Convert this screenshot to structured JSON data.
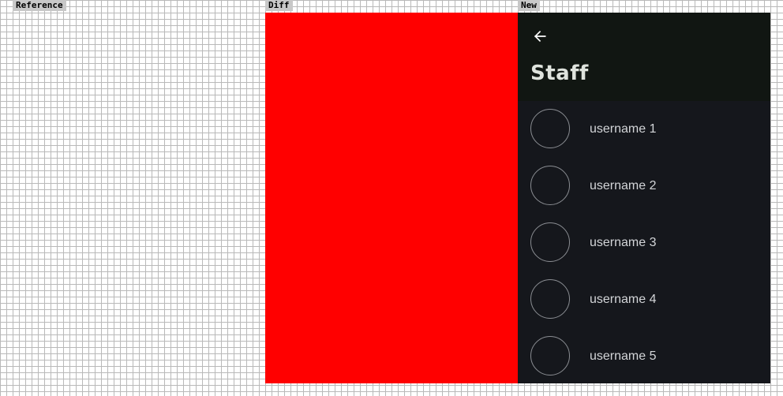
{
  "labels": {
    "reference": "Reference",
    "diff": "Diff",
    "new": "New"
  },
  "colors": {
    "diff_fill": "#ff0000",
    "header_bg": "#111612",
    "list_bg": "#15171c",
    "title_color": "#dfe3dd",
    "text_color": "#d3d5d8",
    "avatar_border": "#8a8d92",
    "back_icon_color": "#ffffff"
  },
  "app": {
    "back_icon": "arrow-left-icon",
    "title": "Staff",
    "staff": [
      {
        "username": "username 1"
      },
      {
        "username": "username 2"
      },
      {
        "username": "username 3"
      },
      {
        "username": "username 4"
      },
      {
        "username": "username 5"
      }
    ]
  }
}
